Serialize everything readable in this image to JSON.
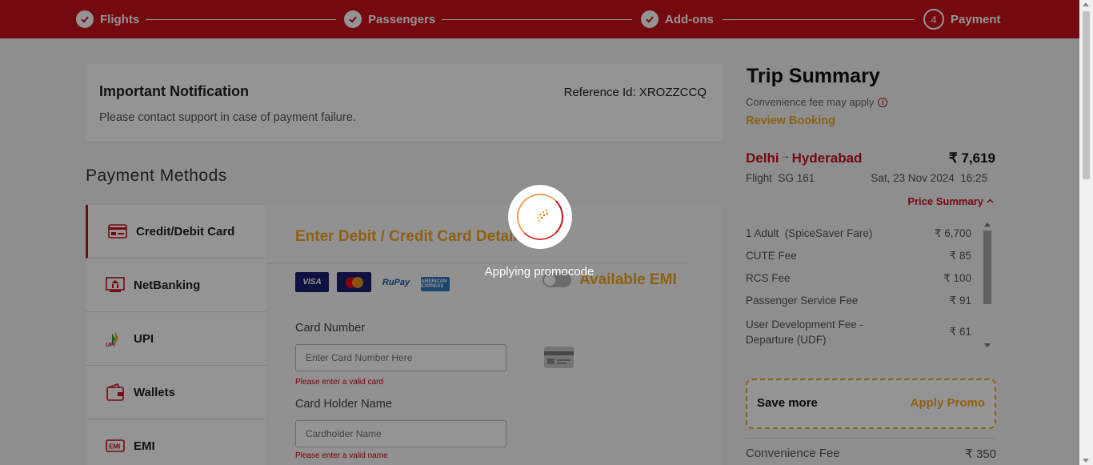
{
  "stepper": {
    "steps": [
      {
        "label": "Flights",
        "state": "done",
        "icon": "check-icon"
      },
      {
        "label": "Passengers",
        "state": "done",
        "icon": "check-icon"
      },
      {
        "label": "Add-ons",
        "state": "done",
        "icon": "check-icon"
      },
      {
        "label": "Payment",
        "state": "current",
        "number": "4"
      }
    ]
  },
  "notification": {
    "title": "Important Notification",
    "reference": "Reference Id: XROZZCCQ",
    "message": "Please contact support in case of payment failure."
  },
  "payment_methods": {
    "heading": "Payment Methods",
    "items": [
      {
        "label": "Credit/Debit Card",
        "icon": "credit-card-icon",
        "active": true
      },
      {
        "label": "NetBanking",
        "icon": "bank-icon",
        "active": false
      },
      {
        "label": "UPI",
        "icon": "upi-icon",
        "active": false
      },
      {
        "label": "Wallets",
        "icon": "wallet-icon",
        "active": false
      },
      {
        "label": "EMI",
        "icon": "emi-icon",
        "active": false
      }
    ]
  },
  "card_form": {
    "title": "Enter Debit / Credit Card Details",
    "brands": {
      "visa": "VISA",
      "rupay": "RuPay",
      "amex": "AMERICAN EXPRESS"
    },
    "emi_label": "Available EMI",
    "card_number": {
      "label": "Card Number",
      "placeholder": "Enter Card Number Here",
      "error": "Please enter a valid card"
    },
    "holder_name": {
      "label": "Card Holder Name",
      "placeholder": "Cardholder Name",
      "error": "Please enter a valid name"
    }
  },
  "summary": {
    "title": "Trip Summary",
    "convenience_note": "Convenience fee may apply",
    "review_link": "Review Booking",
    "origin": "Delhi",
    "destination": "Hyderabad",
    "route_arrow": "→",
    "price": "₹ 7,619",
    "flight": "Flight  SG 161",
    "date_time": "Sat, 23 Nov 2024  16:25",
    "price_summary_link": "Price Summary",
    "fees": [
      {
        "name": "1 Adult  (SpiceSaver Fare)",
        "amount": "₹ 6,700"
      },
      {
        "name": "CUTE Fee",
        "amount": "₹ 85"
      },
      {
        "name": "RCS Fee",
        "amount": "₹ 100"
      },
      {
        "name": "Passenger Service Fee",
        "amount": "₹ 91"
      },
      {
        "name": "User Development Fee - Departure (UDF)",
        "amount": "₹ 61"
      }
    ],
    "promo": {
      "save_label": "Save more",
      "apply_label": "Apply Promo"
    },
    "convenience_fee": {
      "label": "Convenience Fee",
      "amount": "₹ 350"
    }
  },
  "overlay": {
    "loading_text": "Applying promocode"
  },
  "colors": {
    "brand_red": "#c8101d",
    "accent_orange": "#f5a623"
  }
}
